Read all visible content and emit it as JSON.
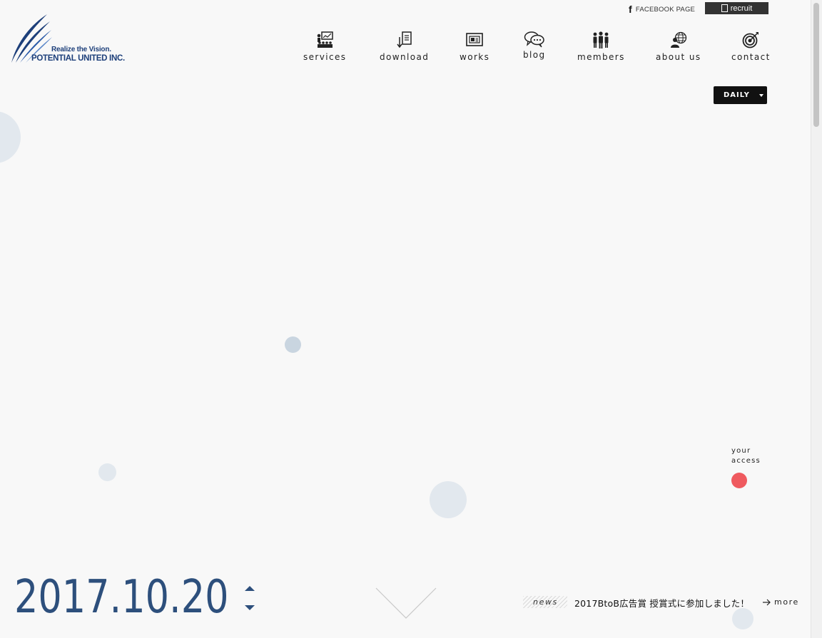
{
  "logo": {
    "tagline": "Realize the Vision.",
    "company": "POTENTIAL UNITED INC."
  },
  "utility": {
    "facebook_icon": "f",
    "facebook_label": "FACEBOOK PAGE",
    "recruit_label": "recruit"
  },
  "nav": {
    "items": [
      {
        "label": "services",
        "icon": "presentation-icon"
      },
      {
        "label": "download",
        "icon": "download-icon"
      },
      {
        "label": "works",
        "icon": "monitor-icon"
      },
      {
        "label": "blog",
        "icon": "chat-bubbles-icon"
      },
      {
        "label": "members",
        "icon": "people-icon"
      },
      {
        "label": "about us",
        "icon": "globe-person-icon"
      },
      {
        "label": "contact",
        "icon": "target-icon"
      }
    ]
  },
  "view_select": {
    "value": "DAILY"
  },
  "access": {
    "label_line1": "your",
    "label_line2": "access",
    "dot_color": "#ef5a5f"
  },
  "date": {
    "value": "2017.10.20",
    "color": "#2d4f7c"
  },
  "news": {
    "tag": "news",
    "headline": "2017BtoB広告賞 授賞式に参加しました！",
    "more_label": "more"
  },
  "colors": {
    "brand_blue": "#1d3f7a",
    "circle_light": "#e2e8ee",
    "circle_mid": "#c9d5e0",
    "background": "#f8f8f8"
  }
}
